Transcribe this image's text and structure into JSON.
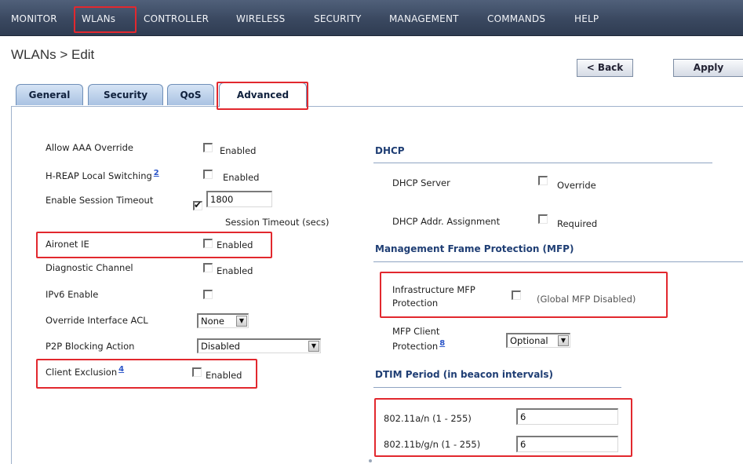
{
  "nav": [
    {
      "label": "MONITOR",
      "name": "nav-monitor"
    },
    {
      "label": "WLANs",
      "name": "nav-wlans"
    },
    {
      "label": "CONTROLLER",
      "name": "nav-controller"
    },
    {
      "label": "WIRELESS",
      "name": "nav-wireless"
    },
    {
      "label": "SECURITY",
      "name": "nav-security"
    },
    {
      "label": "MANAGEMENT",
      "name": "nav-management"
    },
    {
      "label": "COMMANDS",
      "name": "nav-commands"
    },
    {
      "label": "HELP",
      "name": "nav-help"
    }
  ],
  "header": {
    "title": "WLANs > Edit",
    "back": "< Back",
    "apply": "Apply"
  },
  "tabs": {
    "general": "General",
    "security": "Security",
    "qos": "QoS",
    "advanced": "Advanced"
  },
  "left": {
    "aaa": {
      "label": "Allow AAA Override",
      "cb": "Enabled",
      "checked": false
    },
    "hreap": {
      "label": "H-REAP Local Switching",
      "help": "2",
      "cb": "Enabled",
      "checked": false
    },
    "session": {
      "label": "Enable Session Timeout",
      "value": "1800",
      "sub": "Session Timeout (secs)",
      "checked": true
    },
    "aironet": {
      "label": "Aironet IE",
      "cb": "Enabled",
      "checked": false
    },
    "diag": {
      "label": "Diagnostic Channel",
      "cb": "Enabled",
      "checked": false
    },
    "ipv6": {
      "label": "IPv6 Enable",
      "checked": false
    },
    "acl": {
      "label": "Override Interface ACL",
      "value": "None"
    },
    "p2p": {
      "label": "P2P Blocking Action",
      "value": "Disabled"
    },
    "exclusion": {
      "label": "Client Exclusion",
      "help": "4",
      "cb": "Enabled",
      "checked": false
    }
  },
  "right": {
    "dhcp": {
      "title": "DHCP",
      "server": {
        "label": "DHCP Server",
        "cb": "Override",
        "checked": false
      },
      "assign": {
        "label": "DHCP Addr. Assignment",
        "cb": "Required",
        "checked": false
      }
    },
    "mfp": {
      "title": "Management Frame Protection (MFP)",
      "infra_line1": "Infrastructure MFP",
      "infra_line2": "Protection",
      "infra_note": "(Global MFP Disabled)",
      "infra_checked": false,
      "client_line1": "MFP Client",
      "client_line2": "Protection",
      "client_help": "8",
      "client_value": "Optional"
    },
    "dtim": {
      "title": "DTIM Period (in beacon intervals)",
      "a_label": "802.11a/n (1 - 255)",
      "a_value": "6",
      "b_label": "802.11b/g/n (1 - 255)",
      "b_value": "6"
    }
  },
  "colors": {
    "highlight": "#e2282e",
    "nav_bg": "#3a4860",
    "section_title": "#1f3e74"
  }
}
